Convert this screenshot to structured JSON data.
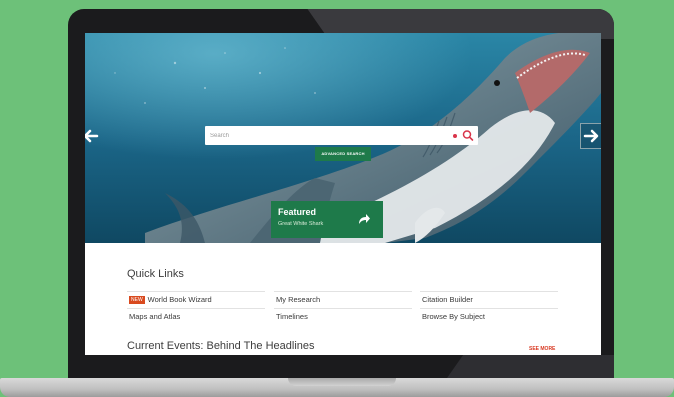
{
  "search": {
    "placeholder": "Search"
  },
  "advanced_search": {
    "label": "ADVANCED SEARCH"
  },
  "featured": {
    "title": "Featured",
    "subtitle": "Great White Shark"
  },
  "quick_links": {
    "title": "Quick Links",
    "badge": "NEW",
    "rows": [
      [
        "World Book Wizard",
        "My Research",
        "Citation Builder"
      ],
      [
        "Maps and Atlas",
        "Timelines",
        "Browse By Subject"
      ]
    ]
  },
  "current_events": {
    "title": "Current Events: Behind The Headlines",
    "see_more": "SEE MORE"
  },
  "colors": {
    "accent_green": "#1e7a4a",
    "badge_red": "#d94a1f",
    "background": "#6dc179"
  },
  "icons": [
    "left-arrow-icon",
    "right-arrow-icon",
    "search-icon",
    "microphone-icon",
    "share-icon"
  ]
}
